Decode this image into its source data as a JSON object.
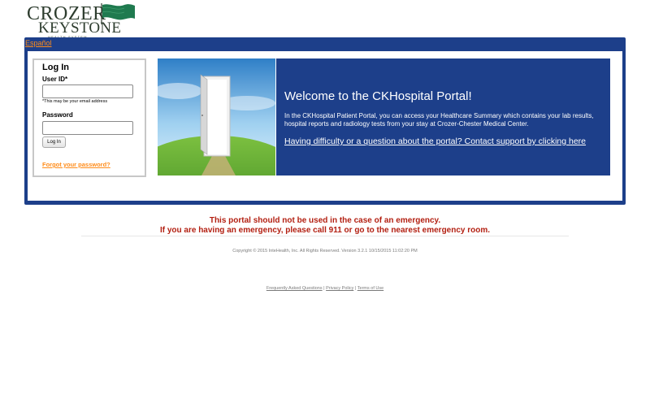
{
  "logo": {
    "line1": "CROZER",
    "line2": "KEYSTONE",
    "line3": "HEALTH SYSTEM",
    "flag_color": "#1f7a4f"
  },
  "language_link": "Español",
  "login": {
    "title": "Log In",
    "userid_label": "User ID*",
    "userid_value": "",
    "userid_hint": "*This may be your email address",
    "password_label": "Password",
    "password_value": "",
    "button_label": "Log In",
    "forgot_link": "Forgot your password?"
  },
  "welcome": {
    "title": "Welcome to the CKHospital Portal!",
    "body": "In the CKHospital Patient Portal, you can access your Healthcare Summary which contains your lab results, hospital reports and radiology tests from your stay at Crozer-Chester Medical Center.",
    "support_link": "Having difficulty or a question about the portal? Contact support by clicking here"
  },
  "warning": {
    "line1": "This portal should not be used in the case of an emergency.",
    "line2": "If you are having an emergency, please call 911 or go to the nearest emergency room."
  },
  "copyright": "Copyright © 2015 InteHealth, Inc. All Rights Reserved. Version 3.2.1 10/15/2015 11:02:20 PM",
  "footer": {
    "faq": "Frequently Asked Questions",
    "privacy": "Privacy Policy",
    "terms": "Terms of Use",
    "separator": "|"
  },
  "colors": {
    "brand_blue": "#1d3f8a",
    "link_orange": "#ff8c1a",
    "warning_red": "#b32012"
  }
}
